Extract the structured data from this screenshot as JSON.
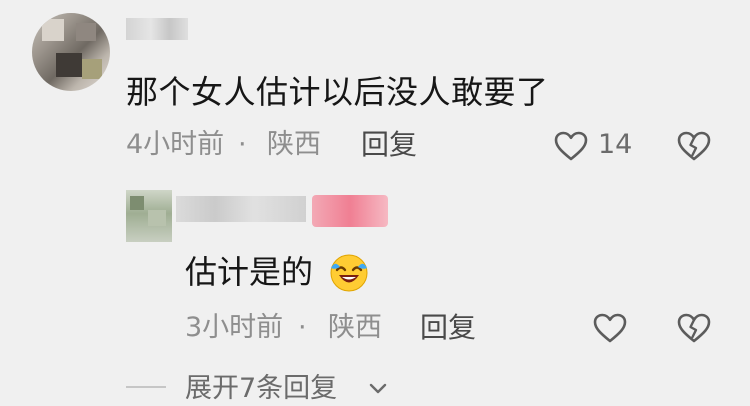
{
  "comment": {
    "text": "那个女人估计以后没人敢要了",
    "time": "4小时前",
    "dot": "·",
    "location": "陕西",
    "reply_label": "回复",
    "like_count": "14",
    "like_icon": "heart-outline-icon",
    "dislike_icon": "broken-heart-icon"
  },
  "reply": {
    "text": "估计是的",
    "emoji": "laughing-crying-emoji",
    "time": "3小时前",
    "dot": "·",
    "location": "陕西",
    "reply_label": "回复",
    "like_icon": "heart-outline-icon",
    "dislike_icon": "broken-heart-icon"
  },
  "expand_replies": {
    "label": "展开7条回复",
    "icon": "chevron-down-icon"
  },
  "colors": {
    "background": "#f0f0f0",
    "text": "#161616",
    "meta": "#8e8e8e",
    "badge": "#f07f93"
  }
}
